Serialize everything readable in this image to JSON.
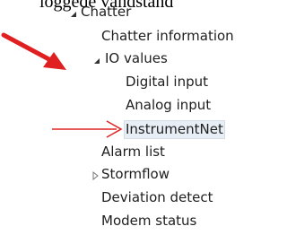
{
  "header_fragment": "loggede vandstand",
  "tree": {
    "root": {
      "label": "Chatter",
      "expanded": true
    },
    "items": [
      {
        "label": "Chatter information"
      },
      {
        "label": "IO values",
        "expanded": true
      },
      {
        "label": "Digital input"
      },
      {
        "label": "Analog input"
      },
      {
        "label": "InstrumentNet",
        "selected": true
      },
      {
        "label": "Alarm list"
      },
      {
        "label": "Stormflow",
        "expanded": false
      },
      {
        "label": "Deviation detect"
      },
      {
        "label": "Modem status"
      }
    ]
  },
  "icons": {
    "expanded": "expanded-triangle-icon",
    "collapsed": "collapsed-triangle-icon",
    "annotation": "red-arrow-annotation"
  },
  "colors": {
    "arrow": "#e02020",
    "selection_bg": "#e8eef5",
    "text": "#1e1e1e"
  }
}
